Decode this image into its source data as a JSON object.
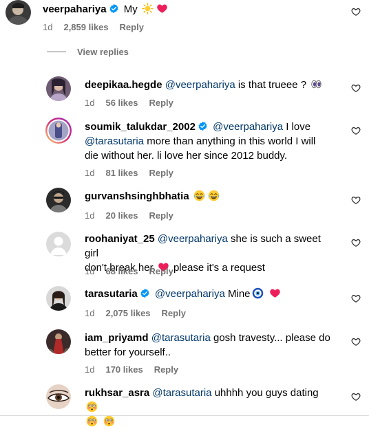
{
  "view_replies_label": "View replies",
  "comments": [
    {
      "user": "veerpahariya",
      "verified": true,
      "mention": "",
      "text": "My",
      "emoji_after": [
        "sun",
        "heart"
      ],
      "time": "1d",
      "likes": "2,859 likes",
      "reply": "Reply"
    },
    {
      "user": "deepikaa.hegde",
      "verified": false,
      "mention": "@veerpahariya",
      "text": "is that trueee ?",
      "emoji_after": [
        "eyes"
      ],
      "time": "1d",
      "likes": "56 likes",
      "reply": "Reply"
    },
    {
      "user": "soumik_talukdar_2002",
      "verified": true,
      "mention": "@veerpahariya",
      "text_1": "I love",
      "mention_2": "@tarasutaria",
      "text_2": "more than anything in this world I will",
      "text_3": "die without her. li love her since 2012 buddy.",
      "time": "1d",
      "likes": "81 likes",
      "reply": "Reply"
    },
    {
      "user": "gurvanshsinghbhatia",
      "verified": false,
      "mention": "",
      "text": "",
      "emoji_after": [
        "laugh",
        "laugh"
      ],
      "time": "1d",
      "likes": "20 likes",
      "reply": "Reply"
    },
    {
      "user": "roohaniyat_25",
      "verified": false,
      "mention": "@veerpahariya",
      "text": "she is such a sweet girl",
      "text_2": "don't break her",
      "text_3": "please it's a request",
      "time": "1d",
      "likes": "68 likes",
      "reply": "Reply"
    },
    {
      "user": "tarasutaria",
      "verified": true,
      "mention": "@veerpahariya",
      "text": "Mine",
      "emoji_after": [
        "nazar",
        "heart"
      ],
      "time": "1d",
      "likes": "2,075 likes",
      "reply": "Reply"
    },
    {
      "user": "iam_priyamd",
      "verified": false,
      "mention": "@tarasutaria",
      "text": "gosh travesty... please do",
      "text_2": "better for yourself..",
      "time": "1d",
      "likes": "170 likes",
      "reply": "Reply"
    },
    {
      "user": "rukhsar_asra",
      "verified": false,
      "mention": "@tarasutaria",
      "text": "uhhhh you guys dating",
      "emoji_after": [
        "flushed"
      ],
      "emoji_line2": [
        "flushed",
        "flushed"
      ]
    }
  ],
  "colors": {
    "mention": "#00376b",
    "meta": "#737373",
    "verified": "#0095f6",
    "heart_red": "#ed4956",
    "story_ring": "#d62976"
  }
}
